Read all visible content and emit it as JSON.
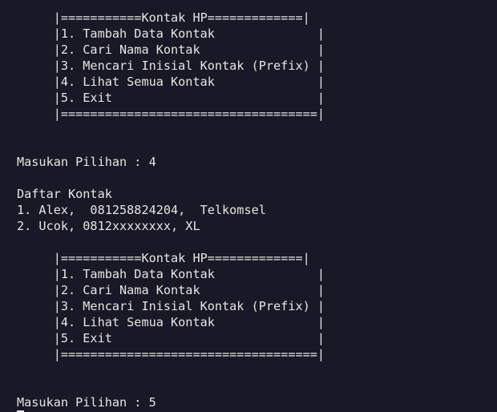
{
  "terminal": {
    "lines": [
      "     |===========Kontak HP=============|",
      "     |1. Tambah Data Kontak              |",
      "     |2. Cari Nama Kontak                |",
      "     |3. Mencari Inisial Kontak (Prefix) |",
      "     |4. Lihat Semua Kontak              |",
      "     |5. Exit                            |",
      "     |===================================|",
      "",
      "",
      "Masukan Pilihan : 4",
      "",
      "Daftar Kontak",
      "1. Alex,  081258824204,  Telkomsel",
      "2. Ucok, 0812xxxxxxxx, XL",
      "",
      "     |===========Kontak HP=============|",
      "     |1. Tambah Data Kontak              |",
      "     |2. Cari Nama Kontak                |",
      "     |3. Mencari Inisial Kontak (Prefix) |",
      "     |4. Lihat Semua Kontak              |",
      "     |5. Exit                            |",
      "     |===================================|",
      "",
      "",
      "Masukan Pilihan : 5"
    ]
  }
}
